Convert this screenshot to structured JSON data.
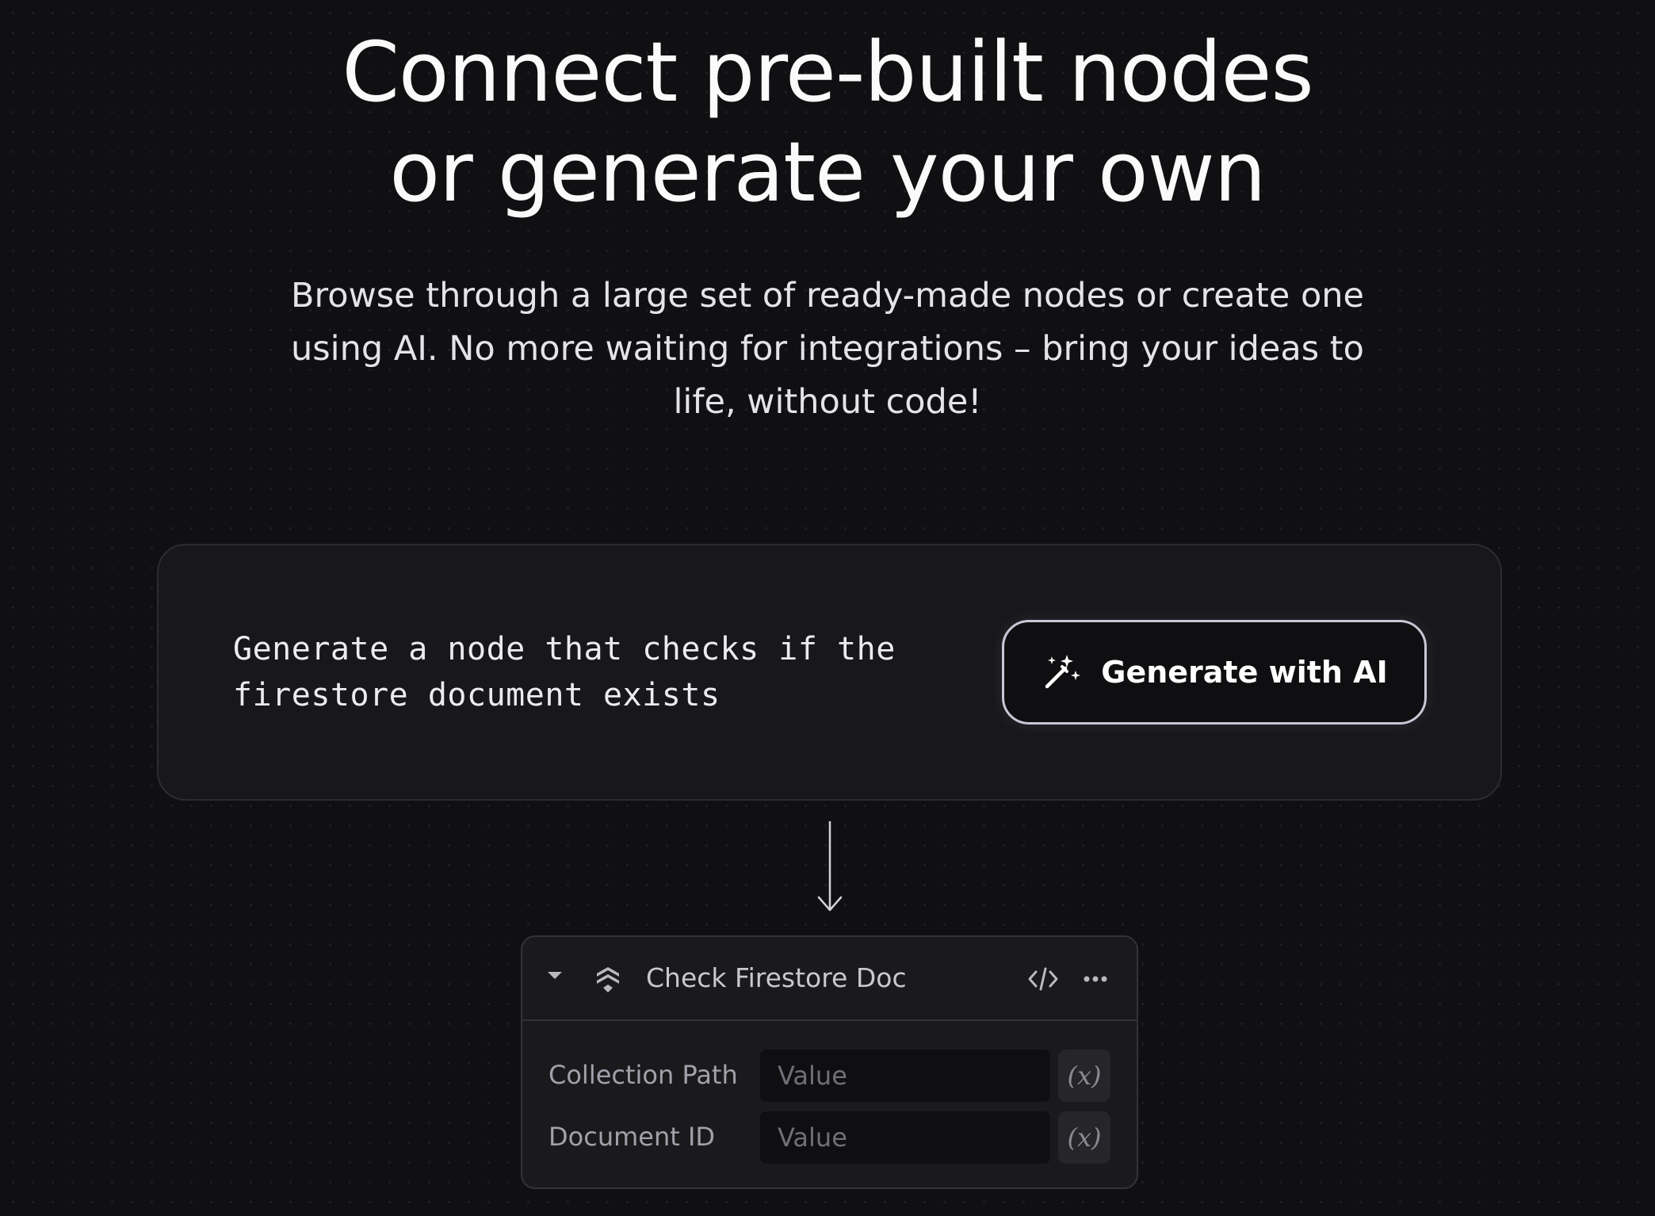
{
  "hero": {
    "title_line1": "Connect pre-built nodes",
    "title_line2": "or generate your own",
    "subtitle_line1": "Browse through a large set of ready-made nodes or create one",
    "subtitle_line2": "using AI. No more waiting for integrations – bring your ideas to",
    "subtitle_line3": "life, without code!"
  },
  "prompt": {
    "line1": "Generate a node that checks if the",
    "line2": "firestore document exists",
    "button_label": "Generate with AI",
    "button_icon": "magic-wand-sparkles-icon"
  },
  "node": {
    "title": "Check Firestore Doc",
    "icon": "firestore-icon",
    "fields": [
      {
        "label": "Collection Path",
        "placeholder": "Value",
        "variable_label": "(x)"
      },
      {
        "label": "Document ID",
        "placeholder": "Value",
        "variable_label": "(x)"
      }
    ]
  },
  "colors": {
    "background": "#101012",
    "card": "#18181b",
    "button_border": "#c8c7d6",
    "text_primary": "#fafafa",
    "text_muted": "#a1a1aa"
  }
}
